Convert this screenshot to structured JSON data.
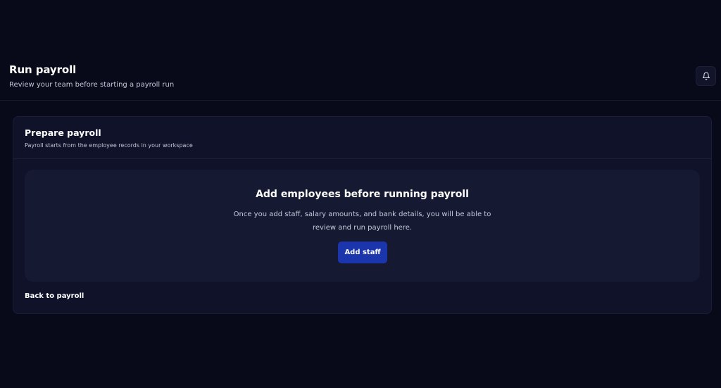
{
  "header": {
    "title": "Run payroll",
    "subtitle": "Review your team before starting a payroll run",
    "notifications_icon": "bell-icon"
  },
  "card": {
    "title": "Prepare payroll",
    "subtitle": "Payroll starts from the employee records in your workspace",
    "empty_state": {
      "heading": "Add employees before running payroll",
      "text": "Once you add staff, salary amounts, and bank details, you will be able to review and run payroll here.",
      "button_label": "Add staff"
    },
    "back_link": "Back to payroll"
  },
  "colors": {
    "background": "#080a1a",
    "card": "#0f1228",
    "panel": "#151931",
    "accent": "#1b35ad"
  }
}
